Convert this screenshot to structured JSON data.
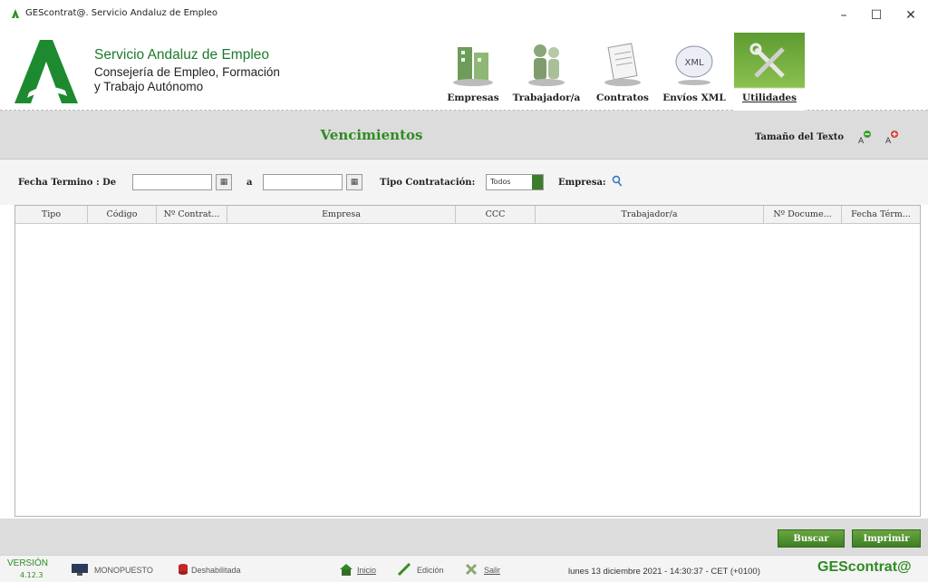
{
  "window": {
    "title": "GEScontrat@. Servicio Andaluz de Empleo",
    "minimize": "–",
    "maximize": "☐",
    "close": "✕"
  },
  "header": {
    "org_name": "Servicio Andaluz de Empleo",
    "org_sub1": "Consejería de Empleo, Formación",
    "org_sub2": "y Trabajo Autónomo",
    "modules": [
      {
        "label": "Empresas",
        "icon": "empresas-icon"
      },
      {
        "label": "Trabajador/a",
        "icon": "trabajador-icon"
      },
      {
        "label": "Contratos",
        "icon": "contratos-icon"
      },
      {
        "label": "Envíos XML",
        "icon": "xml-icon"
      },
      {
        "label": "Utilidades",
        "icon": "utilidades-icon",
        "active": true
      }
    ]
  },
  "banner": {
    "title": "Vencimientos",
    "text_size_label": "Tamaño del Texto"
  },
  "filters": {
    "fecha_label": "Fecha Termino : De",
    "a_label": "a",
    "fecha_de": "",
    "fecha_a": "",
    "tipo_label": "Tipo Contratación:",
    "tipo_value": "Todos",
    "empresa_label": "Empresa:"
  },
  "grid": {
    "columns": [
      "Tipo",
      "Código",
      "Nº Contrat...",
      "Empresa",
      "CCC",
      "Trabajador/a",
      "Nº Docume...",
      "Fecha Térm..."
    ],
    "rows": []
  },
  "actions": {
    "buscar": "Buscar",
    "imprimir": "Imprimir"
  },
  "status": {
    "version_label": "VERSIÓN",
    "version_number": "4.12.3",
    "mode": "MONOPUESTO",
    "db_status": "Deshabilitada",
    "inicio": "Inicio",
    "edicion": "Edición",
    "salir": "Salir",
    "datetime": "lunes 13 diciembre 2021 - 14:30:37 - CET (+0100)",
    "brand": "GEScontrat@"
  },
  "colors": {
    "accent_green": "#2e8b22",
    "banner_gray": "#dcdcdc"
  }
}
